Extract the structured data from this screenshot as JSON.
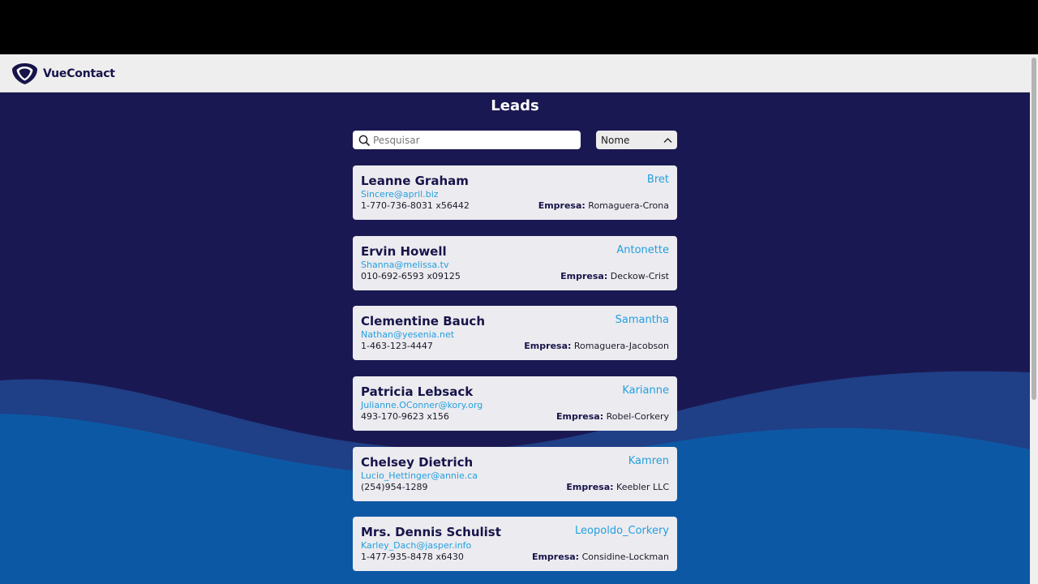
{
  "app": {
    "brand_name": "VueContact",
    "logo_icon": "shield-heart-logo-icon"
  },
  "page": {
    "title": "Leads"
  },
  "search": {
    "placeholder": "Pesquisar",
    "value": "",
    "icon": "search-icon"
  },
  "sort_select": {
    "value": "Nome",
    "icon": "chevron-up-icon"
  },
  "colors": {
    "navy": "#17144a",
    "accent": "#22a0e0",
    "background": "#1a1852",
    "wave": "#0d58a4"
  },
  "leads": [
    {
      "name": "Leanne Graham",
      "username": "Bret",
      "email": "Sincere@april.biz",
      "phone": "1-770-736-8031 x56442",
      "company_label": "Empresa:",
      "company": "Romaguera-Crona"
    },
    {
      "name": "Ervin Howell",
      "username": "Antonette",
      "email": "Shanna@melissa.tv",
      "phone": "010-692-6593 x09125",
      "company_label": "Empresa:",
      "company": "Deckow-Crist"
    },
    {
      "name": "Clementine Bauch",
      "username": "Samantha",
      "email": "Nathan@yesenia.net",
      "phone": "1-463-123-4447",
      "company_label": "Empresa:",
      "company": "Romaguera-Jacobson"
    },
    {
      "name": "Patricia Lebsack",
      "username": "Karianne",
      "email": "Julianne.OConner@kory.org",
      "phone": "493-170-9623 x156",
      "company_label": "Empresa:",
      "company": "Robel-Corkery"
    },
    {
      "name": "Chelsey Dietrich",
      "username": "Kamren",
      "email": "Lucio_Hettinger@annie.ca",
      "phone": "(254)954-1289",
      "company_label": "Empresa:",
      "company": "Keebler LLC"
    },
    {
      "name": "Mrs. Dennis Schulist",
      "username": "Leopoldo_Corkery",
      "email": "Karley_Dach@jasper.info",
      "phone": "1-477-935-8478 x6430",
      "company_label": "Empresa:",
      "company": "Considine-Lockman"
    }
  ]
}
